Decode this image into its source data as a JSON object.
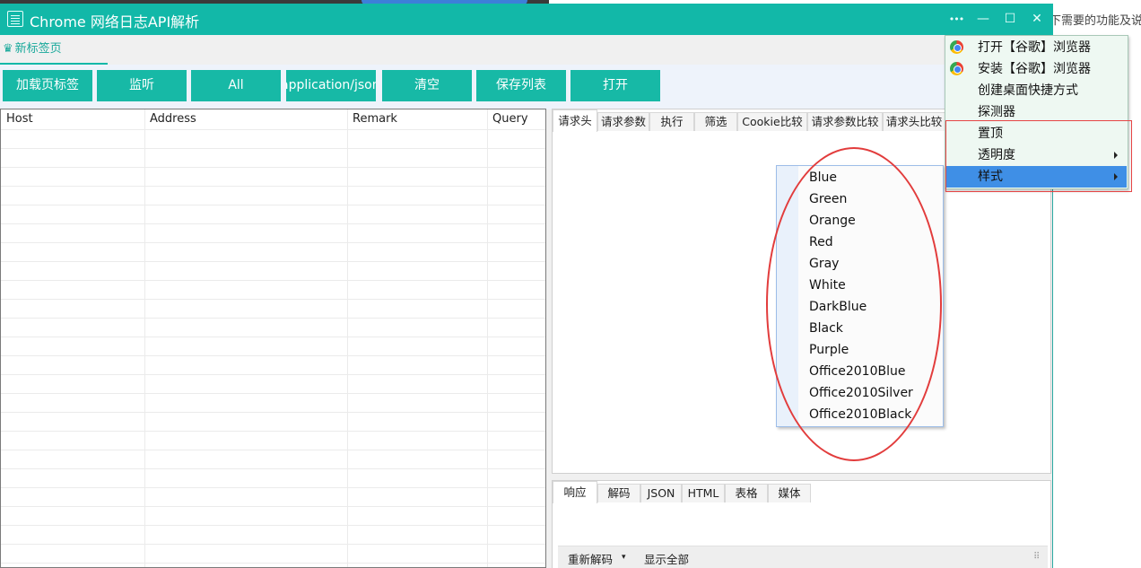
{
  "window": {
    "title": "Chrome 网络日志API解析",
    "controls": {
      "more": "•••",
      "minimize": "—",
      "maximize": "☐",
      "close": "✕"
    },
    "accent": "#12b8a8"
  },
  "background": {
    "text": "下需要的功能及说"
  },
  "doc_tab": {
    "icon": "♛",
    "label": "新标签页"
  },
  "toolbar": {
    "buttons": [
      "加载页标签",
      "监听",
      "All",
      "application/json",
      "清空",
      "保存列表",
      "打开"
    ]
  },
  "table": {
    "columns": [
      "Host",
      "Address",
      "Remark",
      "Query"
    ]
  },
  "request_tabs": [
    "请求头",
    "请求参数",
    "执行",
    "筛选",
    "Cookie比较",
    "请求参数比较",
    "请求头比较"
  ],
  "response_tabs": [
    "响应",
    "解码",
    "JSON",
    "HTML",
    "表格",
    "媒体"
  ],
  "status_bar": {
    "redecode": "重新解码",
    "dropdown_arrow": "▾",
    "show_all": "显示全部",
    "grip": "⠿"
  },
  "context_menu": {
    "items": [
      {
        "label": "打开【谷歌】浏览器",
        "icon": "chrome-icon",
        "has_submenu": false,
        "highlighted": false
      },
      {
        "label": "安装【谷歌】浏览器",
        "icon": "chrome-icon",
        "has_submenu": false,
        "highlighted": false
      },
      {
        "label": "创建桌面快捷方式",
        "icon": "",
        "has_submenu": false,
        "highlighted": false
      },
      {
        "label": "探测器",
        "icon": "",
        "has_submenu": false,
        "highlighted": false
      },
      {
        "label": "置顶",
        "icon": "",
        "has_submenu": false,
        "highlighted": false
      },
      {
        "label": "透明度",
        "icon": "",
        "has_submenu": true,
        "highlighted": false
      },
      {
        "label": "样式",
        "icon": "",
        "has_submenu": true,
        "highlighted": true
      }
    ]
  },
  "style_submenu": {
    "items": [
      "Blue",
      "Green",
      "Orange",
      "Red",
      "Gray",
      "White",
      "DarkBlue",
      "Black",
      "Purple",
      "Office2010Blue",
      "Office2010Silver",
      "Office2010Black"
    ]
  },
  "colors": {
    "button": "#17b9a6",
    "highlight": "#3f8fe6",
    "annotation": "#e23c3c"
  }
}
